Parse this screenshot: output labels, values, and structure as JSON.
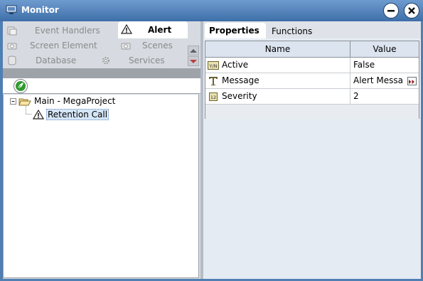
{
  "window": {
    "title": "Monitor"
  },
  "left_tabs": {
    "items": [
      {
        "label": "Event Handlers",
        "icon": "event-handlers-icon"
      },
      {
        "label": "Alert",
        "icon": "alert-icon"
      },
      {
        "label": "Screen Element",
        "icon": "camera-icon"
      },
      {
        "label": "Scenes",
        "icon": "camera-icon"
      },
      {
        "label": "Database",
        "icon": "database-icon"
      },
      {
        "label": "Services",
        "icon": "gear-icon"
      }
    ],
    "active": "Alert"
  },
  "tree": {
    "root": "Main - MegaProject",
    "child": "Retention Call"
  },
  "right_tabs": {
    "items": [
      {
        "label": "Properties"
      },
      {
        "label": "Functions"
      }
    ],
    "active": "Properties"
  },
  "properties": {
    "headers": {
      "name": "Name",
      "value": "Value"
    },
    "rows": [
      {
        "name": "Active",
        "value": "False",
        "icon": "boolean-icon"
      },
      {
        "name": "Message",
        "value": "Alert Messa",
        "icon": "text-icon"
      },
      {
        "name": "Severity",
        "value": "2",
        "icon": "number-icon"
      }
    ]
  },
  "colors": {
    "title_bar": "#4f7fb3",
    "accent": "#2f9a2f"
  }
}
